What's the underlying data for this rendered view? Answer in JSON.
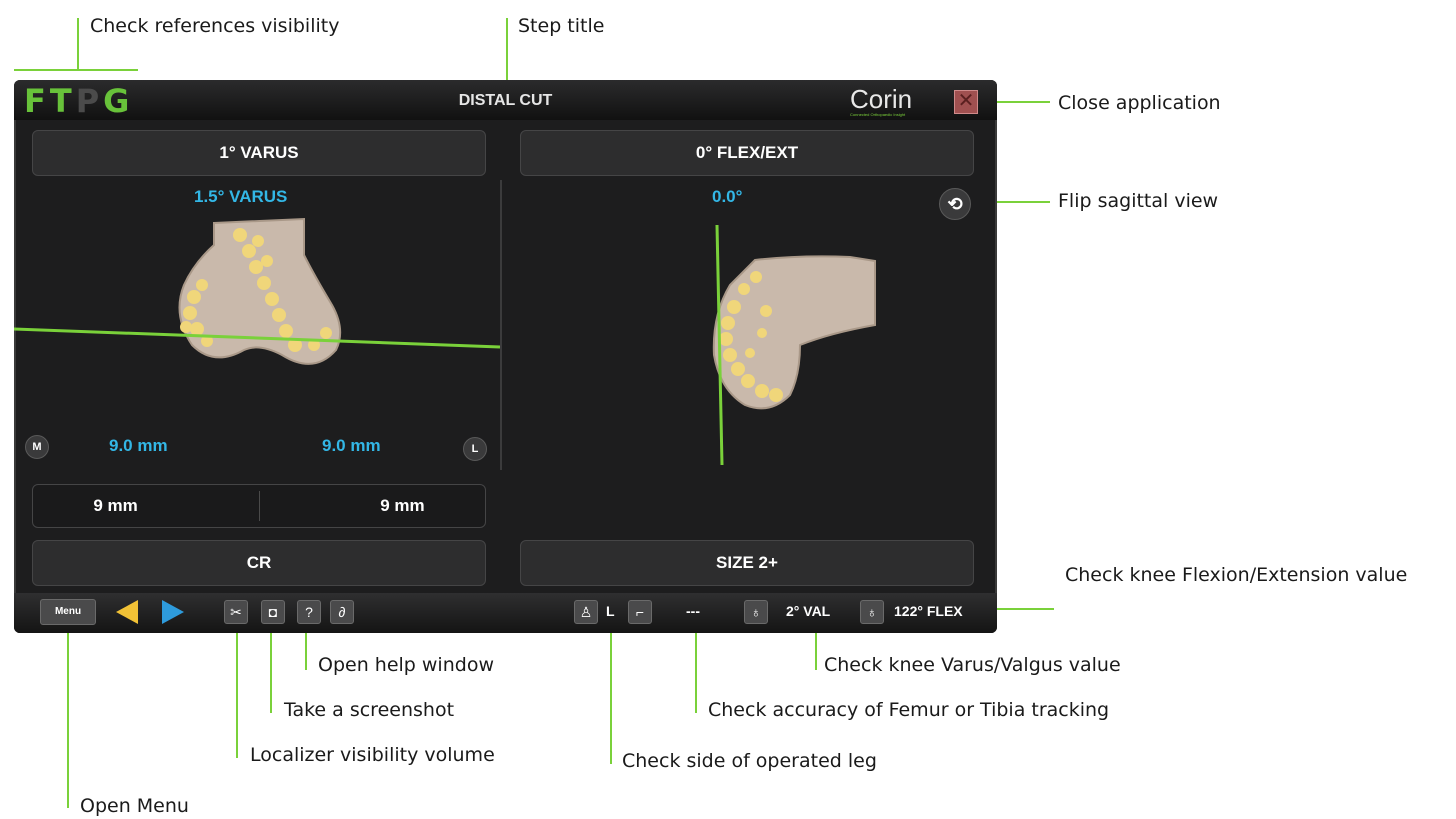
{
  "screen": {
    "references": [
      "F",
      "T",
      "P",
      "G"
    ],
    "reference_colors": [
      "#68c23a",
      "#68c23a",
      "#4b4b4b",
      "#68c23a"
    ],
    "step_title": "DISTAL CUT",
    "brand": "Corin",
    "brand_tagline": "Connected Orthopaedic Insight",
    "close_icon": "close-icon",
    "left": {
      "header": "1° VARUS",
      "measured": "1.5° VARUS",
      "medial_marker": "M",
      "lateral_marker": "L",
      "medial_value": "9.0 mm",
      "lateral_value": "9.0 mm",
      "planned_medial": "9 mm",
      "planned_lateral": "9 mm",
      "footer": "CR"
    },
    "right": {
      "header": "0° FLEX/EXT",
      "measured": "0.0°",
      "footer": "SIZE 2+"
    },
    "toolbar": {
      "menu_label": "Menu",
      "side": "L",
      "accuracy": "---",
      "varus_valgus": "2° VAL",
      "flexion": "122° FLEX"
    },
    "accent_green": "#7ad13a",
    "accent_cyan": "#33b7e6"
  },
  "callouts": {
    "refs": "Check references visibility",
    "step_title": "Step title",
    "close": "Close application",
    "flip": "Flip sagittal view",
    "flex_ext": "Check knee Flexion/Extension value",
    "help": "Open help window",
    "varus_valgus": "Check knee Varus/Valgus value",
    "screenshot": "Take a screenshot",
    "accuracy": "Check accuracy of Femur or Tibia tracking",
    "localizer": "Localizer visibility volume",
    "side": "Check side of operated leg",
    "menu": "Open Menu"
  }
}
